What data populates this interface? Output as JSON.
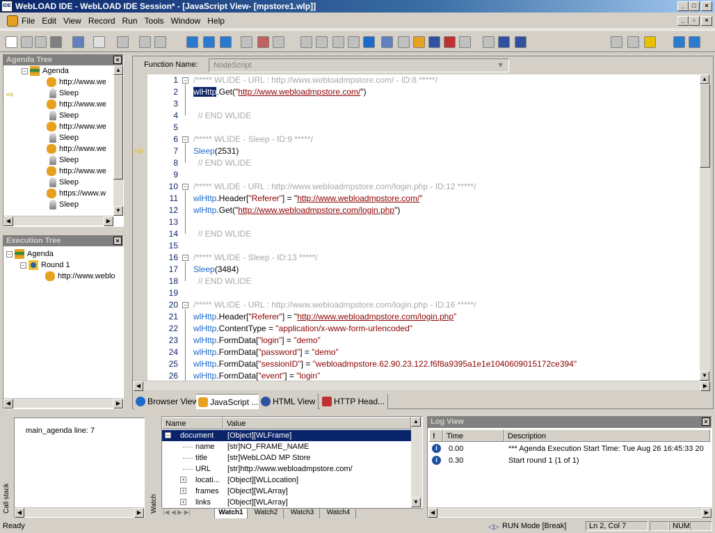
{
  "window": {
    "title": "WebLOAD IDE -  WebLOAD IDE Session* - [JavaScript View- [mpstore1.wlp]]",
    "app_icon_text": "IDE"
  },
  "menu": [
    "File",
    "Edit",
    "View",
    "Record",
    "Run",
    "Tools",
    "Window",
    "Help"
  ],
  "agenda_tree": {
    "title": "Agenda Tree",
    "root": "Agenda",
    "items": [
      "http://www.we",
      "Sleep",
      "http://www.we",
      "Sleep",
      "http://www.we",
      "Sleep",
      "http://www.we",
      "Sleep",
      "http://www.we",
      "Sleep",
      "https://www.w",
      "Sleep"
    ]
  },
  "execution_tree": {
    "title": "Execution Tree",
    "root": "Agenda",
    "round": "Round 1",
    "item": "http://www.weblo"
  },
  "editor": {
    "function_label": "Function Name:",
    "function_value": "NodeScript",
    "lines": [
      {
        "n": "1",
        "segs": [
          {
            "t": "/***** WLIDE - URL : ",
            "c": "cm"
          },
          {
            "t": "http://www.webloadmpstore.com/",
            "c": "cm"
          },
          {
            "t": " - ID:8 *****/",
            "c": "cm"
          }
        ]
      },
      {
        "n": "2",
        "segs": [
          {
            "t": "wlHttp",
            "c": "sel"
          },
          {
            "t": ".Get(\"",
            "c": ""
          },
          {
            "t": "http://www.webloadmpstore.com/",
            "c": "url"
          },
          {
            "t": "\")",
            "c": ""
          }
        ]
      },
      {
        "n": "3",
        "segs": []
      },
      {
        "n": "4",
        "segs": [
          {
            "t": "  // END WLIDE",
            "c": "cm"
          }
        ]
      },
      {
        "n": "5",
        "segs": []
      },
      {
        "n": "6",
        "segs": [
          {
            "t": "/***** WLIDE - Sleep - ID:9 *****/",
            "c": "cm"
          }
        ]
      },
      {
        "n": "7",
        "segs": [
          {
            "t": "Sleep",
            "c": "kw"
          },
          {
            "t": "(2531)",
            "c": ""
          }
        ]
      },
      {
        "n": "8",
        "segs": [
          {
            "t": "  // END WLIDE",
            "c": "cm"
          }
        ]
      },
      {
        "n": "9",
        "segs": []
      },
      {
        "n": "10",
        "segs": [
          {
            "t": "/***** WLIDE - URL : ",
            "c": "cm"
          },
          {
            "t": "http://www.webloadmpstore.com/login.php",
            "c": "cm"
          },
          {
            "t": " - ID:12 *****/",
            "c": "cm"
          }
        ]
      },
      {
        "n": "11",
        "segs": [
          {
            "t": "wlHttp",
            "c": "kw"
          },
          {
            "t": ".Header[",
            "c": ""
          },
          {
            "t": "\"Referer\"",
            "c": "str"
          },
          {
            "t": "] = \"",
            "c": ""
          },
          {
            "t": "http://www.webloadmpstore.com/",
            "c": "url"
          },
          {
            "t": "\"",
            "c": "str"
          }
        ]
      },
      {
        "n": "12",
        "segs": [
          {
            "t": "wlHttp",
            "c": "kw"
          },
          {
            "t": ".Get(\"",
            "c": ""
          },
          {
            "t": "http://www.webloadmpstore.com/login.php",
            "c": "url"
          },
          {
            "t": "\")",
            "c": ""
          }
        ]
      },
      {
        "n": "13",
        "segs": []
      },
      {
        "n": "14",
        "segs": [
          {
            "t": "  // END WLIDE",
            "c": "cm"
          }
        ]
      },
      {
        "n": "15",
        "segs": []
      },
      {
        "n": "16",
        "segs": [
          {
            "t": "/***** WLIDE - Sleep - ID:13 *****/",
            "c": "cm"
          }
        ]
      },
      {
        "n": "17",
        "segs": [
          {
            "t": "Sleep",
            "c": "kw"
          },
          {
            "t": "(3484)",
            "c": ""
          }
        ]
      },
      {
        "n": "18",
        "segs": [
          {
            "t": "  // END WLIDE",
            "c": "cm"
          }
        ]
      },
      {
        "n": "19",
        "segs": []
      },
      {
        "n": "20",
        "segs": [
          {
            "t": "/***** WLIDE - URL : ",
            "c": "cm"
          },
          {
            "t": "http://www.webloadmpstore.com/login.php",
            "c": "cm"
          },
          {
            "t": " - ID:16 *****/",
            "c": "cm"
          }
        ]
      },
      {
        "n": "21",
        "segs": [
          {
            "t": "wlHttp",
            "c": "kw"
          },
          {
            "t": ".Header[",
            "c": ""
          },
          {
            "t": "\"Referer\"",
            "c": "str"
          },
          {
            "t": "] = \"",
            "c": ""
          },
          {
            "t": "http://www.webloadmpstore.com/login.php",
            "c": "url"
          },
          {
            "t": "\"",
            "c": "str"
          }
        ]
      },
      {
        "n": "22",
        "segs": [
          {
            "t": "wlHttp",
            "c": "kw"
          },
          {
            "t": ".ContentType = ",
            "c": ""
          },
          {
            "t": "\"application/x-www-form-urlencoded\"",
            "c": "str"
          }
        ]
      },
      {
        "n": "23",
        "segs": [
          {
            "t": "wlHttp",
            "c": "kw"
          },
          {
            "t": ".FormData[",
            "c": ""
          },
          {
            "t": "\"login\"",
            "c": "str"
          },
          {
            "t": "] = ",
            "c": ""
          },
          {
            "t": "\"demo\"",
            "c": "str"
          }
        ]
      },
      {
        "n": "24",
        "segs": [
          {
            "t": "wlHttp",
            "c": "kw"
          },
          {
            "t": ".FormData[",
            "c": ""
          },
          {
            "t": "\"password\"",
            "c": "str"
          },
          {
            "t": "] = ",
            "c": ""
          },
          {
            "t": "\"demo\"",
            "c": "str"
          }
        ]
      },
      {
        "n": "25",
        "segs": [
          {
            "t": "wlHttp",
            "c": "kw"
          },
          {
            "t": ".FormData[",
            "c": ""
          },
          {
            "t": "\"sessionID\"",
            "c": "str"
          },
          {
            "t": "] = ",
            "c": ""
          },
          {
            "t": "\"webloadmpstore.62.90.23.122.f6f8a9395a1e1e1040609015172ce394\"",
            "c": "str"
          }
        ]
      },
      {
        "n": "26",
        "segs": [
          {
            "t": "wlHttp",
            "c": "kw"
          },
          {
            "t": ".FormData[",
            "c": ""
          },
          {
            "t": "\"event\"",
            "c": "str"
          },
          {
            "t": "] = ",
            "c": ""
          },
          {
            "t": "\"login\"",
            "c": "str"
          }
        ]
      }
    ]
  },
  "editor_tabs": [
    "Browser View",
    "JavaScript ...",
    "HTML View",
    "HTTP Head..."
  ],
  "call_stack": {
    "label": "Call stack",
    "entry": "main_agenda line: 7"
  },
  "watch": {
    "label": "Watch",
    "col_name": "Name",
    "col_value": "Value",
    "rows": [
      {
        "name": "document",
        "value": "[Object][WLFrame]"
      },
      {
        "name": "name",
        "value": "[str]NO_FRAME_NAME"
      },
      {
        "name": "title",
        "value": "[str]WebLOAD MP Store"
      },
      {
        "name": "URL",
        "value": "[str]http://www.webloadmpstore.com/"
      },
      {
        "name": "locati...",
        "value": "[Object][WLLocation]"
      },
      {
        "name": "frames",
        "value": "[Object][WLArray]"
      },
      {
        "name": "links",
        "value": "[Object][WLArray]"
      }
    ],
    "tabs": [
      "Watch1",
      "Watch2",
      "Watch3",
      "Watch4"
    ]
  },
  "log_view": {
    "title": "Log View",
    "col_time": "Time",
    "col_desc": "Description",
    "rows": [
      {
        "time": "0.00",
        "desc": "*** Agenda Execution Start Time:  Tue Aug 26 16:45:33 20"
      },
      {
        "time": "0.30",
        "desc": "Start round 1 (1 of 1)"
      }
    ]
  },
  "status": {
    "ready": "Ready",
    "mode": "RUN Mode [Break]",
    "position": "Ln 2, Col 7",
    "num": "NUM"
  }
}
